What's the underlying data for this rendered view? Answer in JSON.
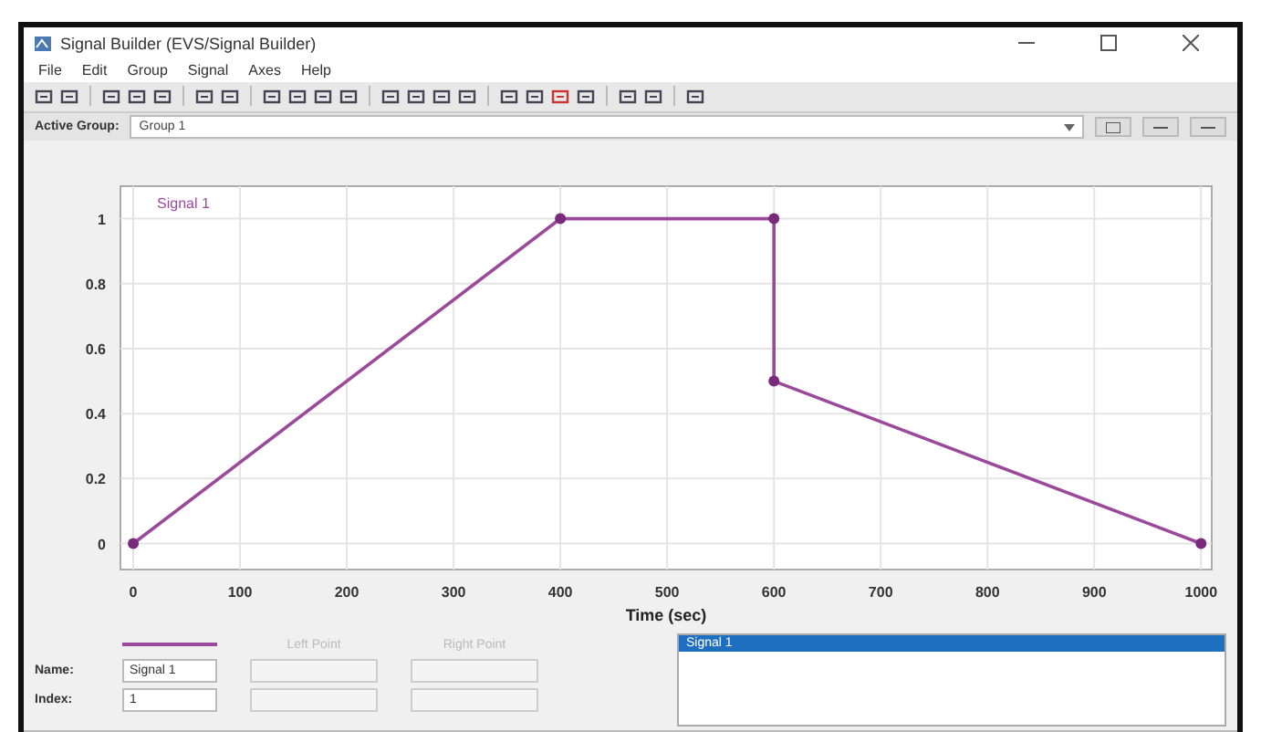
{
  "window": {
    "title": "Signal Builder (EVS/Signal Builder)"
  },
  "menu": [
    "File",
    "Edit",
    "Group",
    "Signal",
    "Axes",
    "Help"
  ],
  "active_group": {
    "label": "Active Group:",
    "value": "Group 1"
  },
  "chart": {
    "chart_data": {
      "type": "line",
      "grid": true,
      "xlabel": "Time (sec)",
      "x": [
        0,
        400,
        600,
        600,
        1000
      ],
      "series": [
        {
          "name": "Signal 1",
          "color": "#9b4a9b",
          "marker": "o",
          "values": [
            0,
            1,
            1,
            0.5,
            0
          ]
        }
      ],
      "xlim": [
        -12,
        1010
      ],
      "ylim": [
        -0.08,
        1.1
      ],
      "xticks": [
        0,
        100,
        200,
        300,
        400,
        500,
        600,
        700,
        800,
        900,
        1000
      ],
      "yticks": [
        0,
        0.2,
        0.4,
        0.6,
        0.8,
        1
      ]
    }
  },
  "signal_panel": {
    "name_label": "Name:",
    "name_value": "Signal 1",
    "index_label": "Index:",
    "index_value": "1",
    "left_point": "Left Point",
    "right_point": "Right Point",
    "left_point_disabled": true,
    "right_point_disabled": true,
    "signals": [
      {
        "label": "Signal 1",
        "selected": true
      }
    ]
  }
}
